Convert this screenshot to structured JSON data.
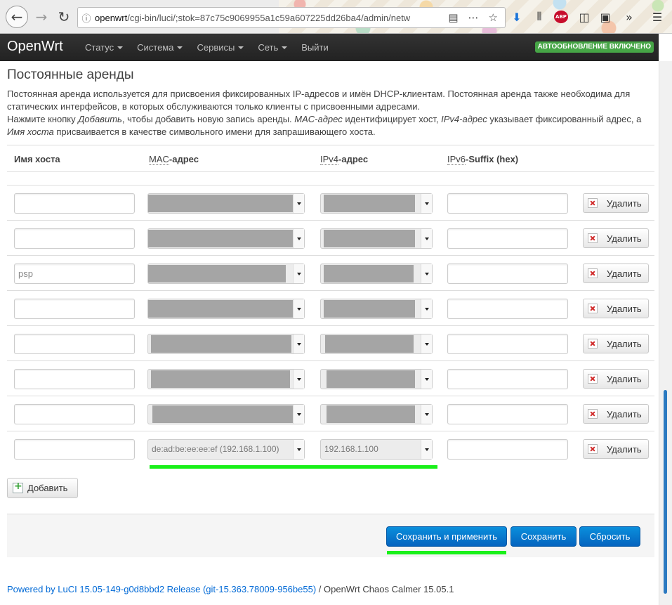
{
  "browser": {
    "url_host": "openwrt",
    "url_path": "/cgi-bin/luci/;stok=87c75c9069955a1c59a607225dd26ba4/admin/netw"
  },
  "header": {
    "brand": "OpenWrt",
    "menu": [
      "Статус",
      "Система",
      "Сервисы",
      "Сеть",
      "Выйти"
    ],
    "autorefresh": "АВТООБНОВЛЕНИЕ ВКЛЮЧЕНО"
  },
  "section": {
    "title": "Постоянные аренды",
    "desc_line1": "Постоянная аренда используется для присвоения фиксированных IP-адресов и имён DHCP-клиентам. Постоянная аренда также необходима для статических интерфейсов, в которых обслуживаются только клиенты с присвоенными адресами.",
    "desc2_a": "Нажмите кнопку ",
    "desc2_add": "Добавить",
    "desc2_b": ", чтобы добавить новую запись аренды. ",
    "desc2_mac": "MAC-адрес",
    "desc2_c": " идентифицирует хост, ",
    "desc2_ipv4": "IPv4-адрес",
    "desc2_d": " указывает фиксированный адрес, а ",
    "desc2_host": "Имя хоста",
    "desc2_e": " присваивается в качестве символьного имени для запрашивающего хоста."
  },
  "table": {
    "col_hostname": "Имя хоста",
    "col_mac_abbr": "MAC",
    "col_mac_rest": "-адрес",
    "col_ipv4_abbr": "IPv4",
    "col_ipv4_rest": "-адрес",
    "col_ipv6_abbr": "IPv6",
    "col_ipv6_rest": "-Suffix (hex)",
    "rows": [
      {
        "hostname": "",
        "mac": "",
        "ipv4": "",
        "ipv6": ""
      },
      {
        "hostname": "",
        "mac": "",
        "ipv4": "",
        "ipv6": ""
      },
      {
        "hostname": "psp",
        "mac": "",
        "ipv4": "",
        "ipv6": ""
      },
      {
        "hostname": "",
        "mac": "",
        "ipv4": "",
        "ipv6": ""
      },
      {
        "hostname": "",
        "mac": "",
        "ipv4": "",
        "ipv6": ""
      },
      {
        "hostname": "",
        "mac": "",
        "ipv4": "",
        "ipv6": ""
      },
      {
        "hostname": "",
        "mac": "",
        "ipv4": "",
        "ipv6": ""
      },
      {
        "hostname": "",
        "mac": "de:ad:be:ee:ee:ef (192.168.1.100)",
        "ipv4": "192.168.1.100",
        "ipv6": ""
      }
    ],
    "delete_label": "Удалить"
  },
  "add_label": "Добавить",
  "actions": {
    "save_apply": "Сохранить и применить",
    "save": "Сохранить",
    "reset": "Сбросить"
  },
  "footer": {
    "link": "Powered by LuCI 15.05-149-g0d8bbd2 Release (git-15.363.78009-956be55)",
    "text": " / OpenWrt Chaos Calmer 15.05.1"
  },
  "colors": {
    "accent_blue": "#0564bf",
    "highlight_green": "#19f019",
    "badge_green": "#46a546"
  }
}
